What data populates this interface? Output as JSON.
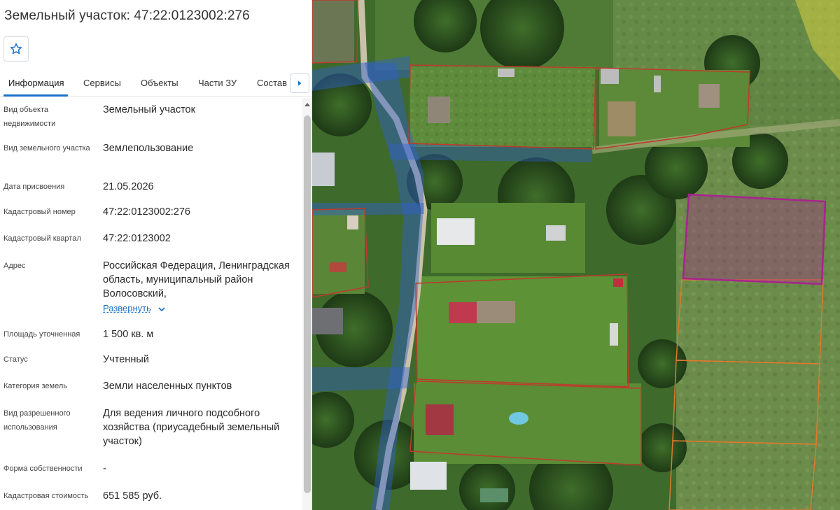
{
  "panel": {
    "title": "Земельный участок: 47:22:0123002:276",
    "favorite_icon": "star-outline-icon",
    "tabs": [
      {
        "label": "Информация",
        "active": true
      },
      {
        "label": "Сервисы",
        "active": false
      },
      {
        "label": "Объекты",
        "active": false
      },
      {
        "label": "Части ЗУ",
        "active": false
      },
      {
        "label": "Состав",
        "active": false
      }
    ],
    "tabs_next_icon": "chevron-right-icon",
    "rows": [
      {
        "label": "Вид объекта недвижимости",
        "value": "Земельный участок"
      },
      {
        "label": "Вид земельного участка",
        "value": "Землепользование"
      },
      {
        "label": "Дата присвоения",
        "value": "21.05.2026"
      },
      {
        "label": "Кадастровый номер",
        "value": "47:22:0123002:276"
      },
      {
        "label": "Кадастровый квартал",
        "value": "47:22:0123002"
      },
      {
        "label": "Адрес",
        "value": "Российская Федерация, Ленинградская область, муниципальный район Волосовский,"
      },
      {
        "label": "Площадь уточненная",
        "value": "1 500 кв. м"
      },
      {
        "label": "Статус",
        "value": "Учтенный"
      },
      {
        "label": "Категория земель",
        "value": "Земли населенных пунктов"
      },
      {
        "label": "Вид разрешенного использования",
        "value": "Для ведения личного подсобного хозяйства (приусадебный земельный участок)"
      },
      {
        "label": "Форма собственности",
        "value": "-"
      },
      {
        "label": "Кадастровая стоимость",
        "value": "651 585 руб."
      }
    ],
    "expand_label": "Развернуть",
    "colors": {
      "accent": "#1a73c9",
      "link": "#1a6fc0"
    }
  },
  "map": {
    "type": "satellite-imagery",
    "selected_parcel_color": "#a8238f",
    "parcel_outline_color": "#c0392b",
    "road_zone_color": "#2f5fd0",
    "zone_fill_color": "#f0e040"
  }
}
